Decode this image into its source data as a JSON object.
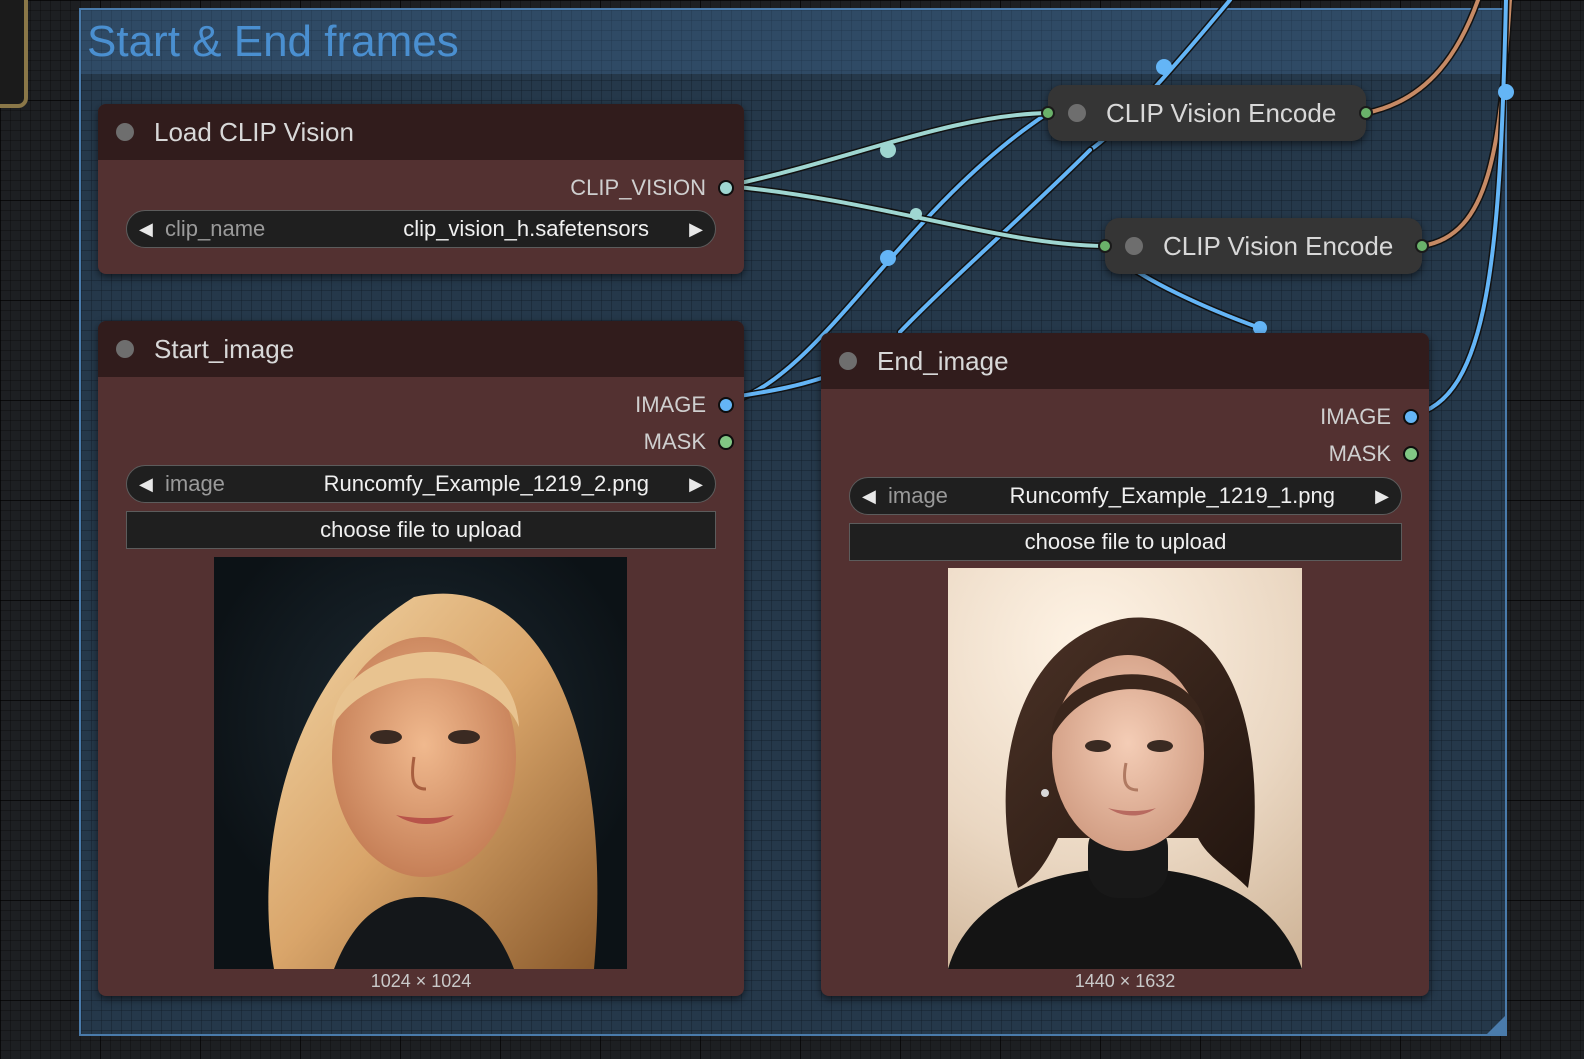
{
  "group": {
    "title": "Start & End frames"
  },
  "load_clip_vision": {
    "title": "Load CLIP Vision",
    "output": "CLIP_VISION",
    "widget": {
      "label": "clip_name",
      "value": "clip_vision_h.safetensors"
    }
  },
  "start_image": {
    "title": "Start_image",
    "outputs": [
      "IMAGE",
      "MASK"
    ],
    "widget": {
      "label": "image",
      "value": "Runcomfy_Example_1219_2.png"
    },
    "upload_label": "choose file to upload",
    "preview_size": "1024 × 1024"
  },
  "end_image": {
    "title": "End_image",
    "outputs": [
      "IMAGE",
      "MASK"
    ],
    "widget": {
      "label": "image",
      "value": "Runcomfy_Example_1219_1.png"
    },
    "upload_label": "choose file to upload",
    "preview_size": "1440 × 1632"
  },
  "clip_encode_1": {
    "title": "CLIP Vision Encode"
  },
  "clip_encode_2": {
    "title": "CLIP Vision Encode"
  },
  "colors": {
    "clip_vision_wire": "#9fd6d1",
    "image_wire": "#64b5f6",
    "mask_slot": "#81c784",
    "output_wire": "#c68a65"
  }
}
